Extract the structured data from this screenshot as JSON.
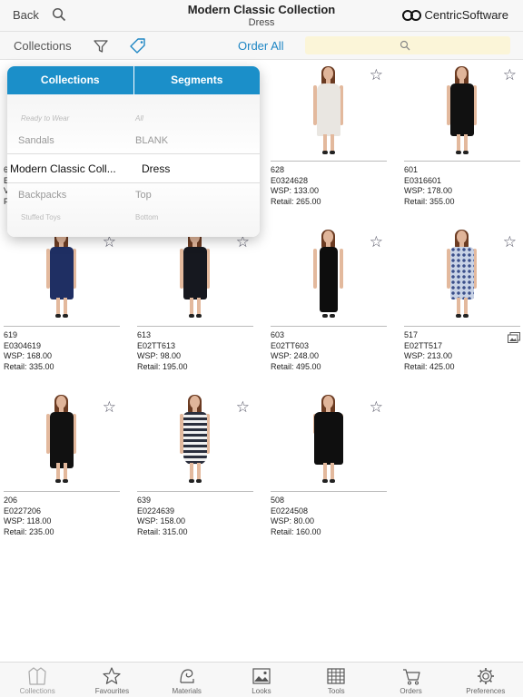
{
  "nav": {
    "back_label": "Back",
    "title": "Modern Classic Collection",
    "subtitle": "Dress",
    "brand_name": "CentricSoftware"
  },
  "toolbar": {
    "collections_label": "Collections",
    "order_all_label": "Order All",
    "search_value": "",
    "search_placeholder": ""
  },
  "popover": {
    "tabs": [
      "Collections",
      "Segments"
    ],
    "rows": [
      {
        "collection": "Ready to Wear",
        "segment": "All"
      },
      {
        "collection": "Sandals",
        "segment": "BLANK"
      },
      {
        "collection": "Modern Classic Coll...",
        "segment": "Dress",
        "selected": true
      },
      {
        "collection": "Backpacks",
        "segment": "Top"
      },
      {
        "collection": "Stuffed Toys",
        "segment": "Bottom"
      }
    ]
  },
  "products": [
    {
      "num": "",
      "code": "",
      "wsp": "",
      "retail": "",
      "dress_color": "#111111",
      "hidden": true
    },
    {
      "num": "",
      "code": "",
      "wsp": "",
      "retail": "",
      "dress_color": "#111111",
      "hidden": true
    },
    {
      "num": "628",
      "code": "E0324628",
      "wsp": "WSP: 133.00",
      "retail": "Retail: 265.00",
      "dress_color": "#e9e6e1"
    },
    {
      "num": "601",
      "code": "E0316601",
      "wsp": "WSP: 178.00",
      "retail": "Retail: 355.00",
      "dress_color": "#111111"
    },
    {
      "num": "619",
      "code": "E0304619",
      "wsp": "WSP: 168.00",
      "retail": "Retail: 335.00",
      "dress_color": "#1f2f63"
    },
    {
      "num": "613",
      "code": "E02TT613",
      "wsp": "WSP: 98.00",
      "retail": "Retail: 195.00",
      "dress_color": "#16181f"
    },
    {
      "num": "603",
      "code": "E02TT603",
      "wsp": "WSP: 248.00",
      "retail": "Retail: 495.00",
      "dress_color": "#0d0d0d"
    },
    {
      "num": "517",
      "code": "E02TT517",
      "wsp": "WSP: 213.00",
      "retail": "Retail: 425.00",
      "dress_color": "#c9d3e6",
      "multi_image": true
    },
    {
      "num": "206",
      "code": "E0227206",
      "wsp": "WSP: 118.00",
      "retail": "Retail: 235.00",
      "dress_color": "#111111"
    },
    {
      "num": "639",
      "code": "E0224639",
      "wsp": "WSP: 158.00",
      "retail": "Retail: 315.00",
      "dress_color": "#3a3e4e"
    },
    {
      "num": "508",
      "code": "E0224508",
      "wsp": "WSP: 80.00",
      "retail": "Retail: 160.00",
      "dress_color": "#0f0f0f"
    }
  ],
  "tabbar": [
    {
      "label": "Collections",
      "icon": "jacket-icon",
      "active": true
    },
    {
      "label": "Favourites",
      "icon": "star-icon"
    },
    {
      "label": "Materials",
      "icon": "fabric-icon"
    },
    {
      "label": "Looks",
      "icon": "image-icon"
    },
    {
      "label": "Tools",
      "icon": "grid-icon"
    },
    {
      "label": "Orders",
      "icon": "cart-icon"
    },
    {
      "label": "Preferences",
      "icon": "gear-icon"
    }
  ],
  "colors": {
    "accent": "#1b8fc9",
    "link": "#1e86c4",
    "search_bg": "#fbf5d8"
  }
}
